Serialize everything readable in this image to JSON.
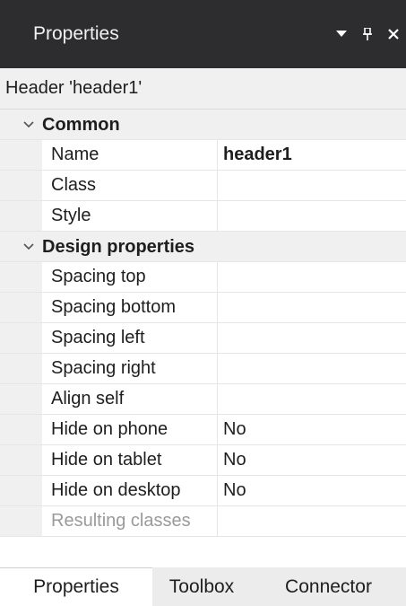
{
  "titlebar": {
    "title": "Properties",
    "controls": [
      "chevron-down-icon",
      "pin-icon",
      "close-icon"
    ]
  },
  "object_header": {
    "text": "Header 'header1'"
  },
  "grid": {
    "categories": [
      {
        "label": "Common",
        "rows": [
          {
            "name": "Name",
            "value": "header1",
            "bold": true
          },
          {
            "name": "Class",
            "value": ""
          },
          {
            "name": "Style",
            "value": ""
          }
        ]
      },
      {
        "label": "Design properties",
        "rows": [
          {
            "name": "Spacing top",
            "value": ""
          },
          {
            "name": "Spacing bottom",
            "value": ""
          },
          {
            "name": "Spacing left",
            "value": ""
          },
          {
            "name": "Spacing right",
            "value": ""
          },
          {
            "name": "Align self",
            "value": ""
          },
          {
            "name": "Hide on phone",
            "value": "No"
          },
          {
            "name": "Hide on tablet",
            "value": "No"
          },
          {
            "name": "Hide on desktop",
            "value": "No"
          },
          {
            "name": "Resulting classes",
            "value": "",
            "dim": true
          }
        ]
      }
    ]
  },
  "tabs": [
    {
      "label": "Properties",
      "active": true
    },
    {
      "label": "Toolbox",
      "active": false
    },
    {
      "label": "Connector",
      "active": false
    }
  ]
}
